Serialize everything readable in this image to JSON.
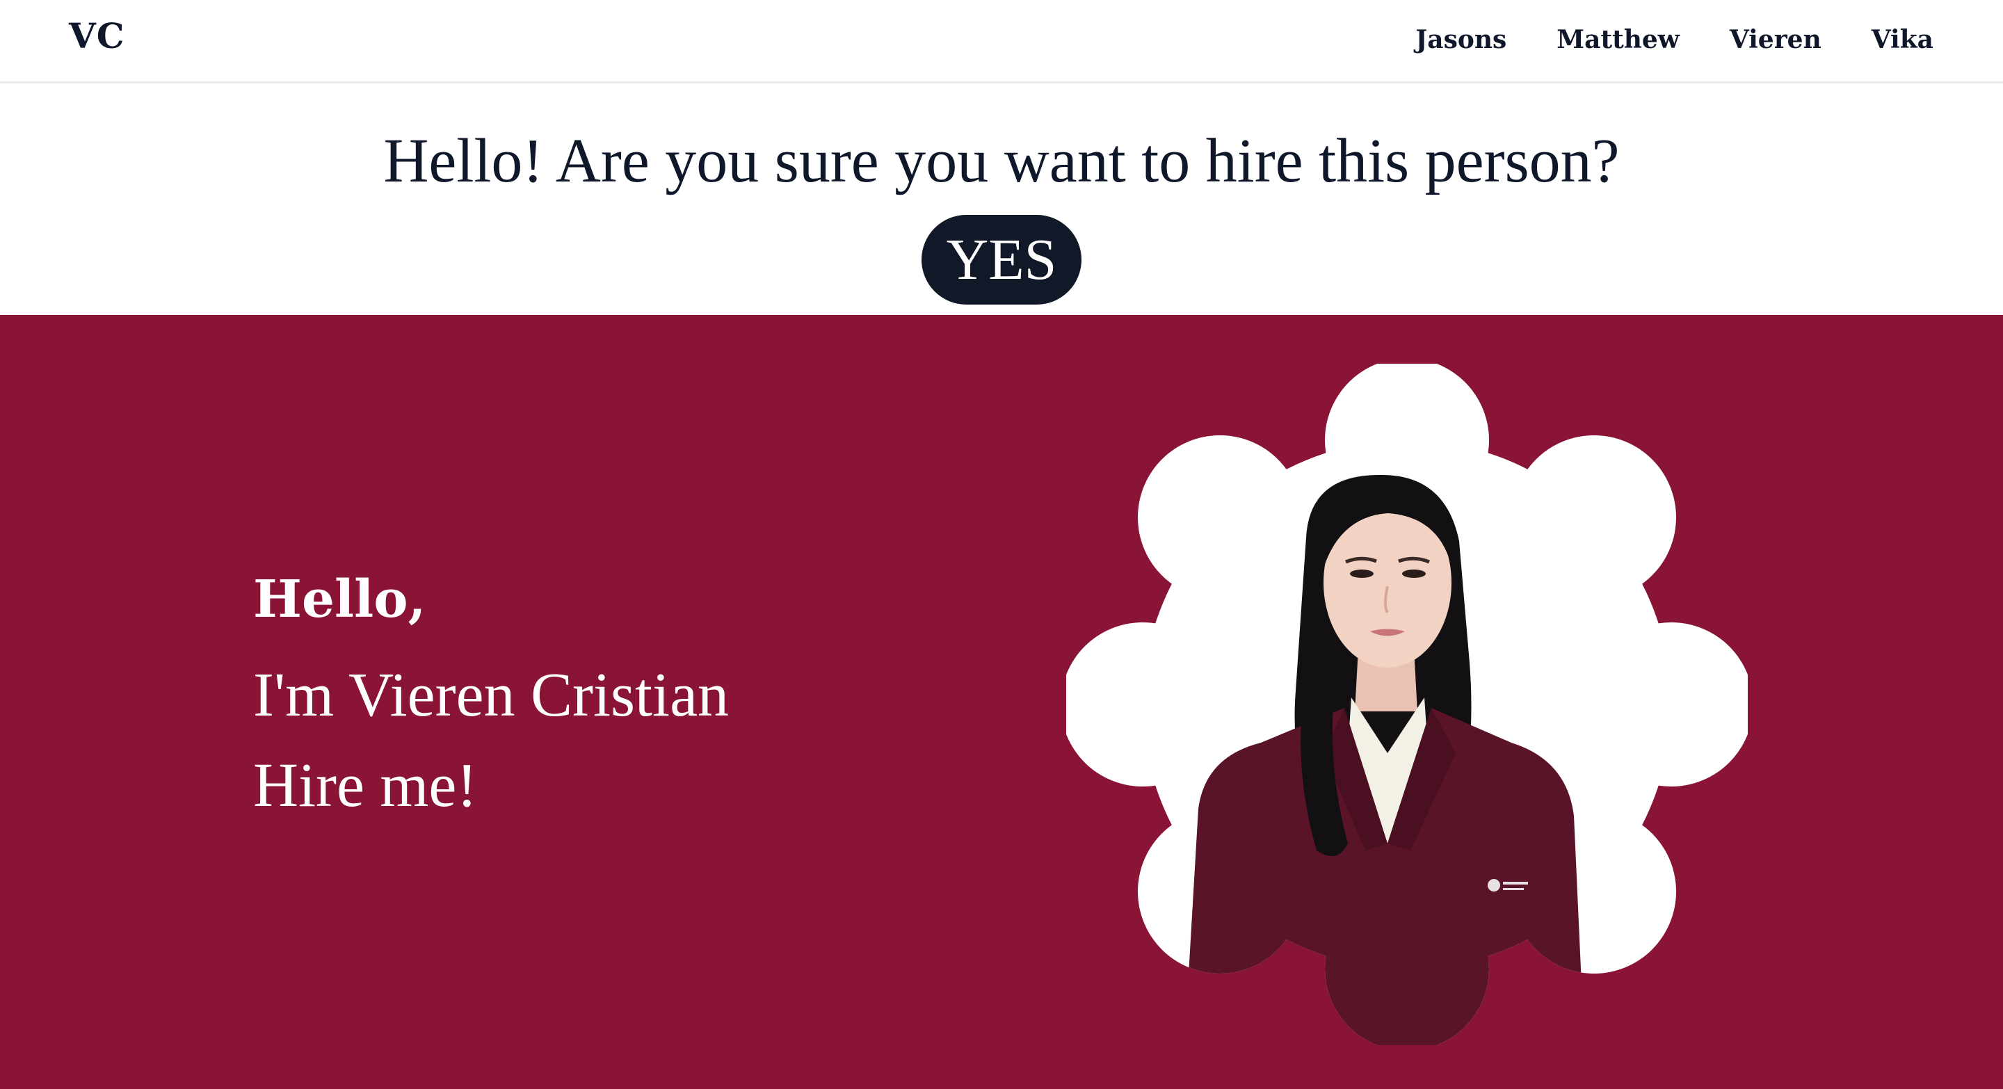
{
  "nav": {
    "brand": "VC",
    "links": [
      "Jasons",
      "Matthew",
      "Vieren",
      "Vika"
    ]
  },
  "prompt": {
    "question": "Hello! Are you sure you want to hire this person?",
    "yes_label": "YES"
  },
  "hero": {
    "greeting": "Hello,",
    "name_line": "I'm Vieren Cristian",
    "cta_line": "Hire me!",
    "photo": "profile-photo",
    "colors": {
      "background": "#8a1435",
      "blob": "#ffffff",
      "blazer": "#5a1428"
    }
  },
  "colors": {
    "text_dark": "#0f172a",
    "button_bg": "#111827"
  }
}
